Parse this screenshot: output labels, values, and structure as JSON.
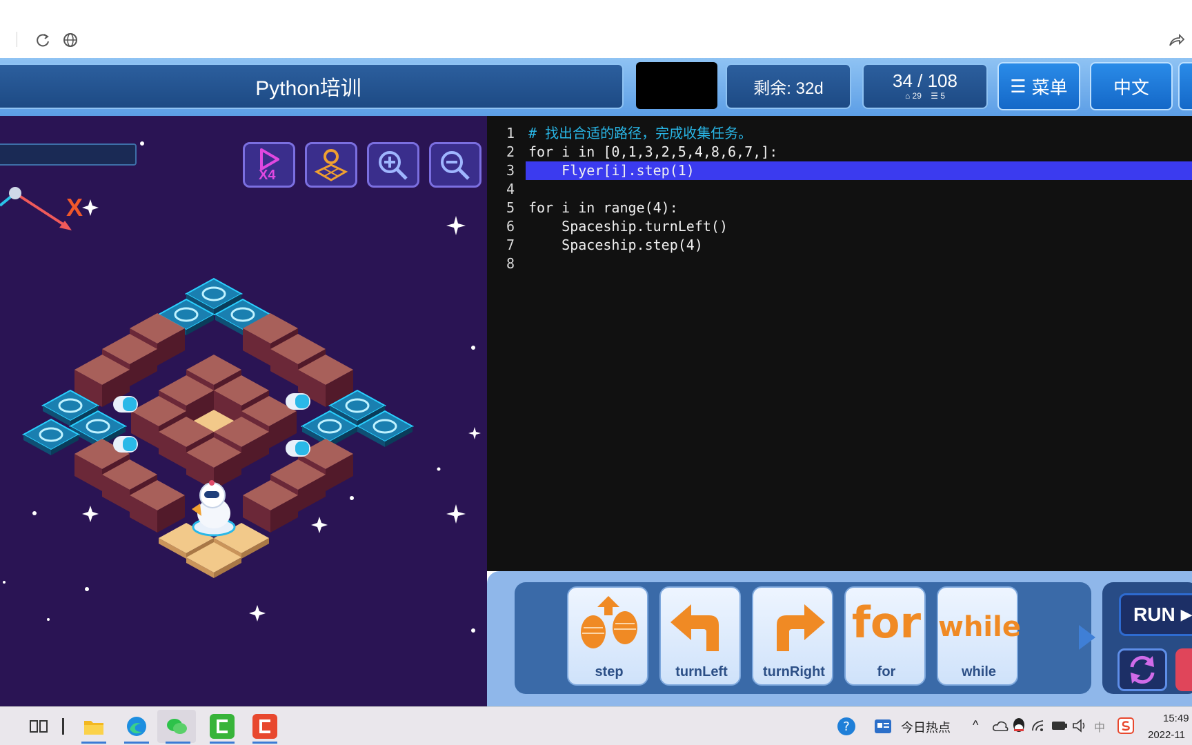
{
  "header": {
    "title": "Python培训",
    "remaining": "剩余: 32d",
    "level_progress": "34 / 108",
    "level_sub_a": "29",
    "level_sub_b": "5",
    "menu_label": "菜单",
    "language_label": "中文"
  },
  "editor": {
    "lines": [
      {
        "n": "1",
        "text": "# 找出合适的路径，完成收集任务。"
      },
      {
        "n": "2",
        "text": "for i in [0,1,3,2,5,4,8,6,7,]:"
      },
      {
        "n": "3",
        "text": "    Flyer[i].step(1)"
      },
      {
        "n": "4",
        "text": ""
      },
      {
        "n": "5",
        "text": "for i in range(4):"
      },
      {
        "n": "6",
        "text": "    Spaceship.turnLeft()"
      },
      {
        "n": "7",
        "text": "    Spaceship.step(4)"
      },
      {
        "n": "8",
        "text": ""
      }
    ],
    "highlight_line": "3"
  },
  "game": {
    "axis_label": "X",
    "speed_label": "X4"
  },
  "commands": [
    {
      "label": "step"
    },
    {
      "label": "turnLeft"
    },
    {
      "label": "turnRight"
    },
    {
      "label": "for",
      "big": "for"
    },
    {
      "label": "while",
      "big": "while"
    }
  ],
  "run": {
    "label": "RUN"
  },
  "taskbar": {
    "news_label": "今日热点",
    "ime_label": "中",
    "time": "15:49",
    "date": "2022-11"
  },
  "colors": {
    "header_bg": "#5c9ee6",
    "editor_bg": "#111111",
    "highlight": "#3b3bef",
    "comment": "#29b6e6",
    "number": "#e06c43",
    "function": "#f0c36b",
    "game_bg": "#2a1454",
    "command_accent": "#f08a24"
  }
}
